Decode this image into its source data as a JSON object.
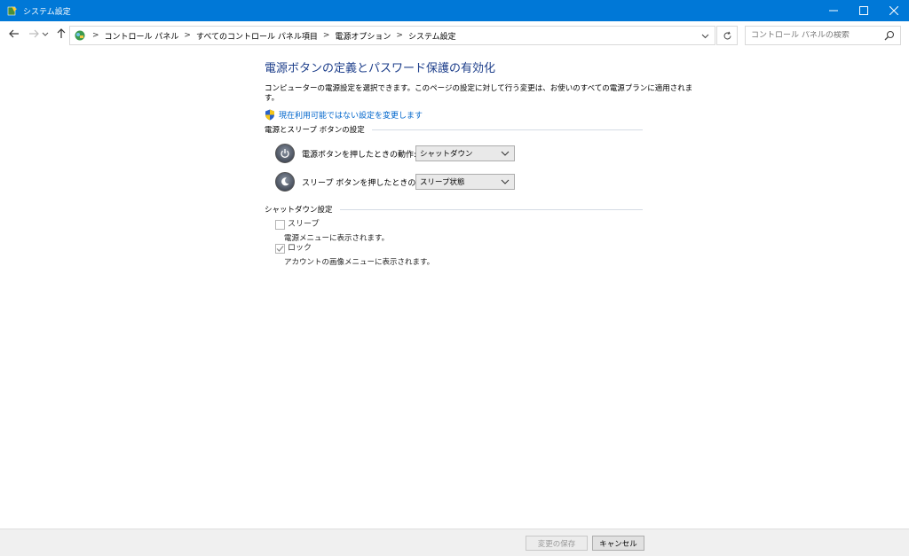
{
  "window": {
    "title": "システム設定"
  },
  "navigation": {
    "breadcrumbs": [
      "コントロール パネル",
      "すべてのコントロール パネル項目",
      "電源オプション",
      "システム設定"
    ],
    "search_placeholder": "コントロール パネルの検索"
  },
  "main": {
    "title": "電源ボタンの定義とパスワード保護の有効化",
    "description_line1": "コンピューターの電源設定を選択できます。このページの設定に対して行う変更は、お使いのすべての電源プランに適用されま",
    "description_line2": "す。",
    "admin_link": "現在利用可能ではない設定を変更します",
    "power_section": {
      "header": "電源とスリープ ボタンの設定",
      "power_button_label": "電源ボタンを押したときの動作:",
      "power_button_value": "シャットダウン",
      "sleep_button_label": "スリープ ボタンを押したときの動作:",
      "sleep_button_value": "スリープ状態"
    },
    "shutdown_section": {
      "header": "シャットダウン設定",
      "items": [
        {
          "label": "スリープ",
          "sub": "電源メニューに表示されます。",
          "checked": false
        },
        {
          "label": "ロック",
          "sub": "アカウントの画像メニューに表示されます。",
          "checked": true
        }
      ]
    }
  },
  "footer": {
    "save_label": "変更の保存",
    "cancel_label": "キャンセル"
  },
  "colors": {
    "titlebar": "#0078d7",
    "heading": "#1e3f8b",
    "link": "#0066cc"
  }
}
